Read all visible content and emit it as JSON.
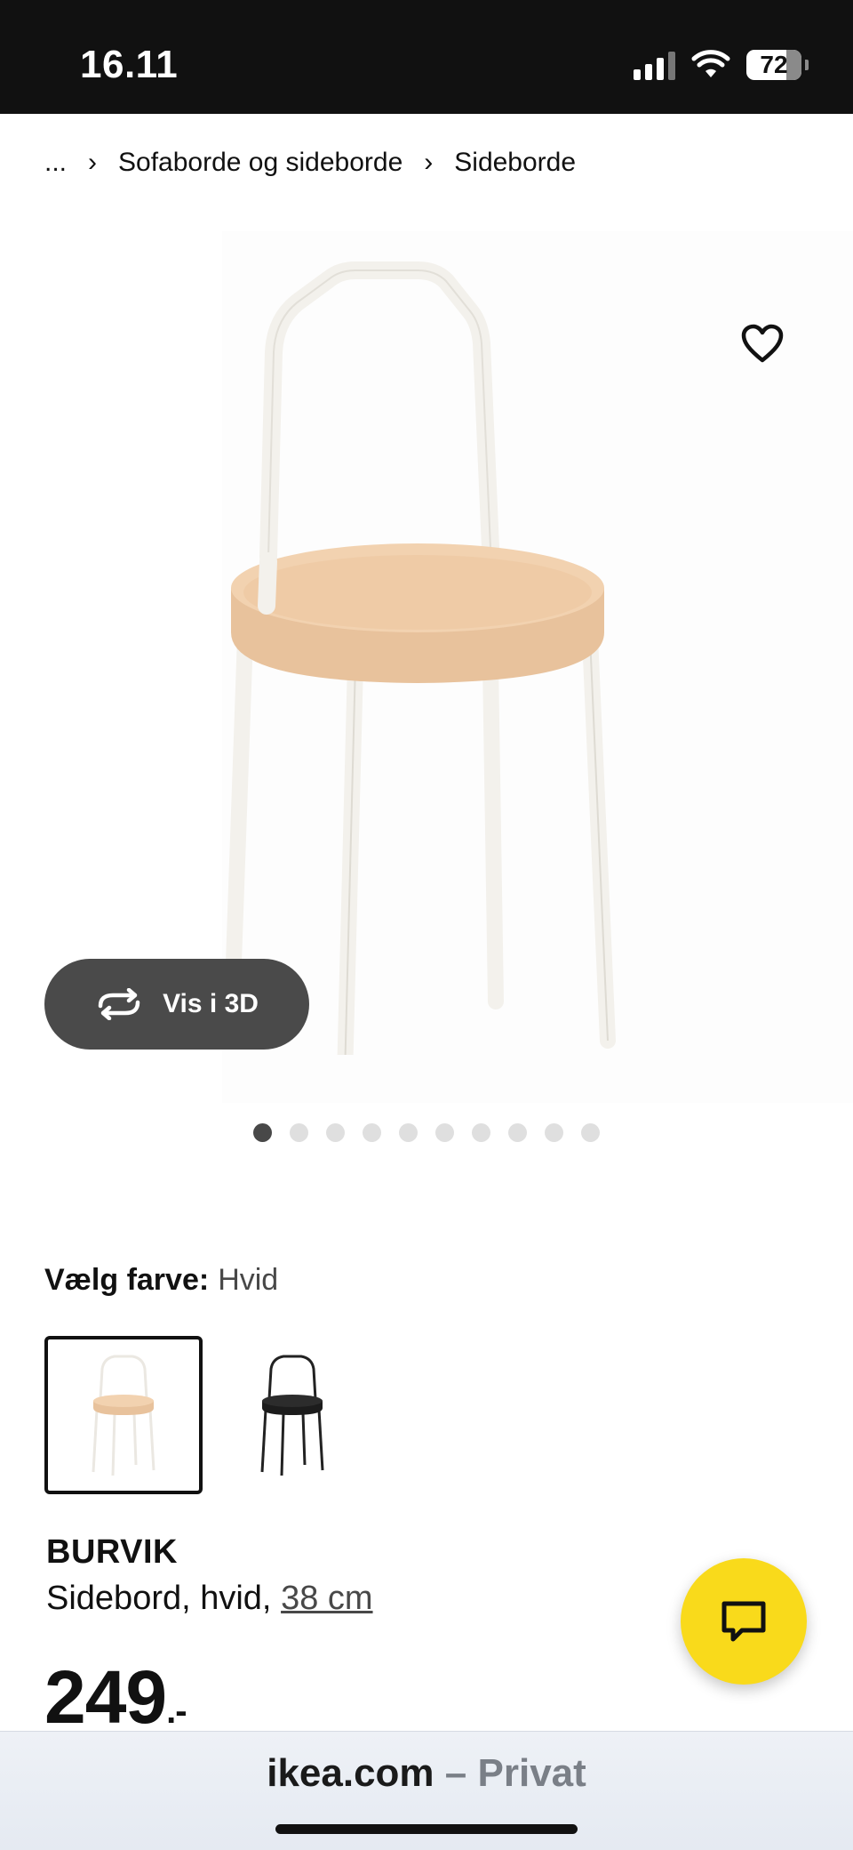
{
  "status_bar": {
    "time": "16.11",
    "battery_level": "72",
    "icons": [
      "cellular-signal-icon",
      "wifi-icon",
      "battery-icon"
    ]
  },
  "breadcrumb": {
    "ellipsis": "...",
    "items": [
      "Sofaborde og sideborde",
      "Sideborde"
    ]
  },
  "gallery": {
    "view_3d_label": "Vis i 3D",
    "image_count": 10,
    "active_image_index": 0,
    "favorite_icon": "heart-icon",
    "view_3d_icon": "rotate-arrows-icon"
  },
  "color_selection": {
    "label": "Vælg farve:",
    "selected_value": "Hvid",
    "options": [
      "Hvid",
      "Sort"
    ],
    "selected_index": 0
  },
  "product": {
    "name": "BURVIK",
    "description": "Sidebord, hvid,",
    "size_link": "38 cm",
    "price": "249",
    "price_suffix": ".-"
  },
  "chat": {
    "icon": "chat-bubble-icon"
  },
  "browser": {
    "domain": "ikea.com",
    "mode": "– Privat"
  },
  "colors": {
    "brand_yellow": "#f9da1b",
    "status_bar_bg": "#111111",
    "view_3d_bg": "#4a4a4a",
    "table_wood": "#f2d2b0",
    "table_frame_white": "#f3f1ec"
  }
}
